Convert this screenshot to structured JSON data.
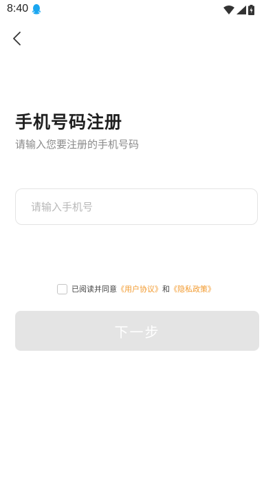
{
  "status_bar": {
    "time": "8:40",
    "app_icon": "qq-penguin-icon",
    "icons": [
      "wifi-icon",
      "cellular-signal-icon",
      "battery-charging-icon"
    ]
  },
  "nav": {
    "back_icon": "chevron-left-icon"
  },
  "header": {
    "title": "手机号码注册",
    "subtitle": "请输入您要注册的手机号码"
  },
  "phone_input": {
    "placeholder": "请输入手机号",
    "value": ""
  },
  "agreement": {
    "checked": false,
    "prefix": "已阅读并同意",
    "user_agreement": "《用户协议》",
    "conjunction": "和",
    "privacy_policy": "《隐私政策》",
    "link_color": "#f29a2e"
  },
  "next_button": {
    "label": "下一步",
    "enabled": false
  }
}
